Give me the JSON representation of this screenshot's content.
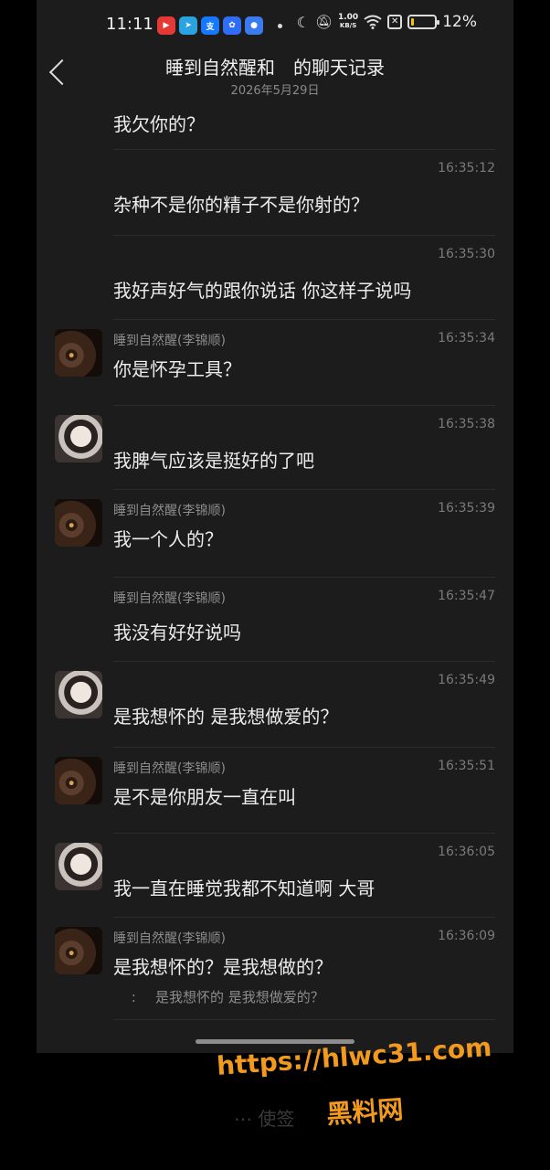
{
  "status_bar": {
    "time": "11:11",
    "net_speed_value": "1.00",
    "net_speed_unit": "KB/S",
    "battery": "12%",
    "battery_level": 0.12
  },
  "header": {
    "title": "睡到自然醒和　的聊天记录",
    "date": "2026年5月29日"
  },
  "messages": [
    {
      "avatar": "",
      "sender": "",
      "time": "",
      "text": "我欠你的？",
      "quote": ""
    },
    {
      "avatar": "",
      "sender": "",
      "time": "16:35:12",
      "text": "杂种不是你的精子不是你射的？",
      "quote": ""
    },
    {
      "avatar": "",
      "sender": "",
      "time": "16:35:30",
      "text": "我好声好气的跟你说话 你这样子说吗",
      "quote": ""
    },
    {
      "avatar": "male",
      "sender": "睡到自然醒(李锦顺)",
      "time": "16:35:34",
      "text": "你是怀孕工具？",
      "quote": ""
    },
    {
      "avatar": "female",
      "sender": "",
      "time": "16:35:38",
      "text": "我脾气应该是挺好的了吧",
      "quote": ""
    },
    {
      "avatar": "male",
      "sender": "睡到自然醒(李锦顺)",
      "time": "16:35:39",
      "text": "我一个人的？",
      "quote": ""
    },
    {
      "avatar": "",
      "sender": "睡到自然醒(李锦顺)",
      "time": "16:35:47",
      "text": "我没有好好说吗",
      "quote": ""
    },
    {
      "avatar": "female",
      "sender": "",
      "time": "16:35:49",
      "text": "是我想怀的 是我想做爱的？",
      "quote": ""
    },
    {
      "avatar": "male",
      "sender": "睡到自然醒(李锦顺)",
      "time": "16:35:51",
      "text": "是不是你朋友一直在叫",
      "quote": ""
    },
    {
      "avatar": "female",
      "sender": "",
      "time": "16:36:05",
      "text": "我一直在睡觉我都不知道啊 大哥",
      "quote": ""
    },
    {
      "avatar": "male",
      "sender": "睡到自然醒(李锦顺)",
      "time": "16:36:09",
      "text": "是我想怀的？是我想做的？",
      "quote": "是我想怀的 是我想做爱的？"
    }
  ],
  "watermark": {
    "url": "https://hlwc31.com",
    "name": "黑料网"
  },
  "colors": {
    "background": "#1c1c1c",
    "watermark": "#f29a1e"
  }
}
